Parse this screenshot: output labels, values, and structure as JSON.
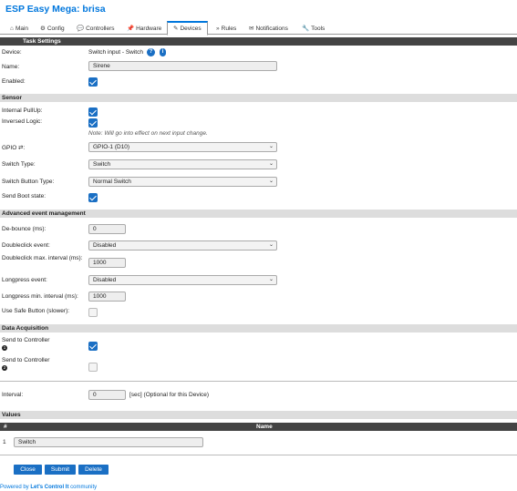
{
  "app": {
    "title": "ESP Easy Mega: brisa"
  },
  "menu": {
    "tabs": [
      {
        "icon": "⌂",
        "label": "Main"
      },
      {
        "icon": "⚙",
        "label": "Config"
      },
      {
        "icon": "💬",
        "label": "Controllers"
      },
      {
        "icon": "📌",
        "label": "Hardware"
      },
      {
        "icon": "✎",
        "label": "Devices"
      },
      {
        "icon": "»",
        "label": "Rules"
      },
      {
        "icon": "✉",
        "label": "Notifications"
      },
      {
        "icon": "🔧",
        "label": "Tools"
      }
    ],
    "active": "Devices"
  },
  "task_settings": {
    "header": "Task Settings",
    "device_label": "Device:",
    "device_value": "Switch input - Switch",
    "help_icon": "?",
    "info_icon": "i",
    "name_label": "Name:",
    "name_value": "Sirene",
    "enabled_label": "Enabled:",
    "enabled": true
  },
  "sensor": {
    "header": "Sensor",
    "internal_pullup_label": "Internal PullUp:",
    "internal_pullup": true,
    "inversed_logic_label": "Inversed Logic:",
    "inversed_logic": true,
    "note": "Note: Will go into effect on next input change.",
    "gpio_label": "GPIO ⇄:",
    "gpio_value": "GPIO-1 (D10)",
    "switch_type_label": "Switch Type:",
    "switch_type_value": "Switch",
    "switch_button_type_label": "Switch Button Type:",
    "switch_button_type_value": "Normal Switch",
    "send_boot_state_label": "Send Boot state:",
    "send_boot_state": true
  },
  "advanced": {
    "header": "Advanced event management",
    "debounce_label": "De-bounce (ms):",
    "debounce_value": "0",
    "doubleclick_label": "Doubleclick event:",
    "doubleclick_value": "Disabled",
    "doubleclick_interval_label": "Doubleclick max. interval (ms):",
    "doubleclick_interval_value": "1000",
    "longpress_label": "Longpress event:",
    "longpress_value": "Disabled",
    "longpress_interval_label": "Longpress min. interval (ms):",
    "longpress_interval_value": "1000",
    "safe_button_label": "Use Safe Button (slower):",
    "safe_button": false
  },
  "data_acquisition": {
    "header": "Data Acquisition",
    "send_controller_1_label": "Send to Controller",
    "send_controller_1_num": "1",
    "send_controller_1": true,
    "send_controller_2_label": "Send to Controller",
    "send_controller_2_num": "2",
    "send_controller_2": false,
    "interval_label": "Interval:",
    "interval_value": "0",
    "interval_note": "[sec] (Optional for this Device)"
  },
  "values": {
    "header": "Values",
    "col_num": "#",
    "col_name": "Name",
    "rows": [
      {
        "num": "1",
        "name": "Switch"
      }
    ]
  },
  "buttons": {
    "close": "Close",
    "submit": "Submit",
    "delete": "Delete"
  },
  "footer": {
    "prefix": "Powered by ",
    "brand": "Let's Control It",
    "suffix": " community"
  }
}
